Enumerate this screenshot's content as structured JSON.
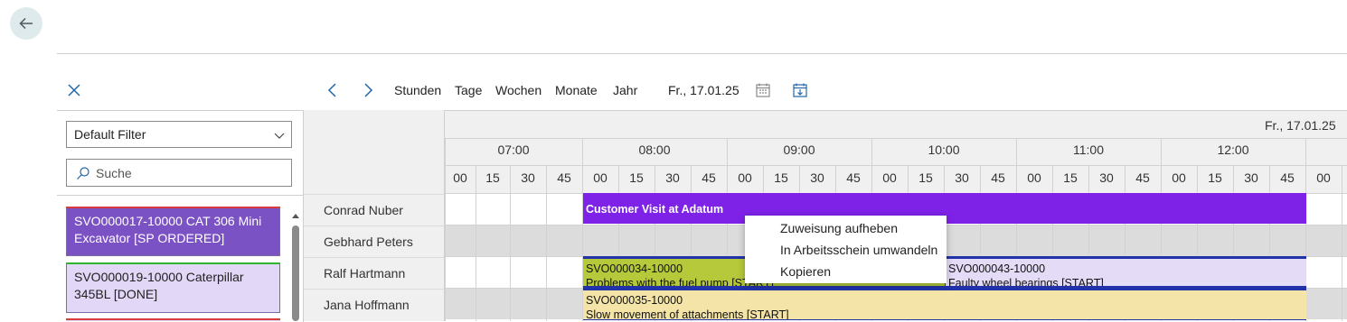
{
  "header": {
    "back_icon": "arrow-left-icon"
  },
  "toolbar": {
    "close_icon": "close-icon",
    "prev_icon": "chevron-left-icon",
    "next_icon": "chevron-right-icon",
    "views": [
      "Stunden",
      "Tage",
      "Wochen",
      "Monate",
      "Jahr"
    ],
    "date": "Fr., 17.01.25",
    "calendar_icon": "calendar-icon",
    "today_icon": "calendar-today-icon"
  },
  "left_panel": {
    "filter_value": "Default Filter",
    "search_placeholder": "Suche",
    "cards": [
      {
        "text": "SVO000017-10000 CAT 306 Mini Excavator [SP ORDERED]",
        "line1": "SVO000017-10000 CAT 306 Mini",
        "line2": "Excavator [SP ORDERED]",
        "bg": "#7b52c4",
        "fg": "#ffffff",
        "top_color": "#d83b3b"
      },
      {
        "text": "SVO000019-10000 Caterpillar 345BL [DONE]",
        "line1": "SVO000019-10000 Caterpillar",
        "line2": "345BL [DONE]",
        "bg": "#e2d7f6",
        "fg": "#222222",
        "top_color": "#2fb52f"
      }
    ]
  },
  "scheduler": {
    "date_header": "Fr., 17.01.25",
    "hours": [
      "07:00",
      "08:00",
      "09:00",
      "10:00",
      "11:00",
      "12:00"
    ],
    "minutes": [
      "00",
      "15",
      "30",
      "45"
    ],
    "resources": [
      "Conrad Nuber",
      "Gebhard Peters",
      "Ralf Hartmann",
      "Jana Hoffmann"
    ],
    "appointments": [
      {
        "title": "Customer Visit at Adatum",
        "line2": "",
        "bg": "#7e22e8",
        "fg": "#ffffff"
      },
      {
        "title": "SVO000034-10000",
        "line2": "Problems with the fuel pump [START]",
        "bg": "#b5c93a",
        "fg": "#111111"
      },
      {
        "title": "SVO000043-10000",
        "line2": "Faulty wheel bearings [START]",
        "bg": "#e4dcf7",
        "fg": "#111111"
      },
      {
        "title": "SVO000035-10000",
        "line2": "Slow movement of attachments [START]",
        "bg": "#f4e4a8",
        "fg": "#111111"
      }
    ],
    "colors": {
      "accent_bar": "#2233aa",
      "grid_line": "#d2d2d2",
      "header_bg": "#f0f0f0"
    }
  },
  "context_menu": {
    "items": [
      "Zuweisung aufheben",
      "In Arbeitsschein umwandeln",
      "Kopieren"
    ]
  }
}
